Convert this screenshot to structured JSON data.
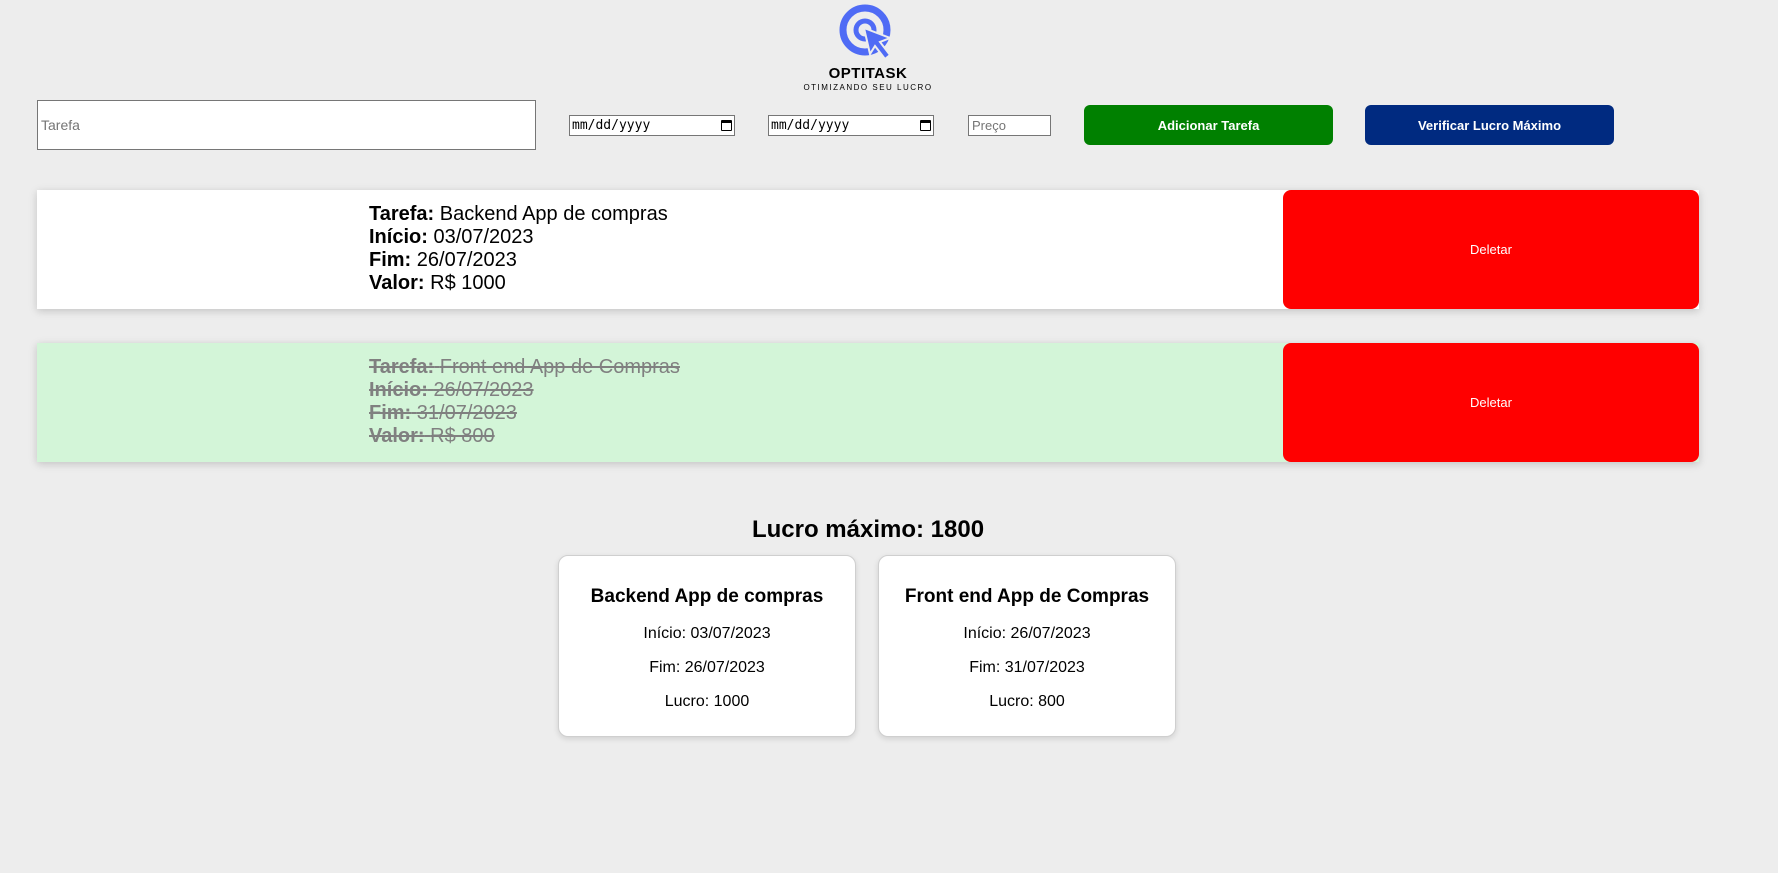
{
  "logo": {
    "title": "OPTITASK",
    "subtitle": "OTIMIZANDO SEU LUCRO",
    "icon": "cursor-target-icon",
    "color": "#4f6bf5"
  },
  "form": {
    "task_placeholder": "Tarefa",
    "start_date_placeholder": "mm/dd/yyyy",
    "end_date_placeholder": "mm/dd/yyyy",
    "price_placeholder": "Preço",
    "add_label": "Adicionar Tarefa",
    "check_label": "Verificar Lucro Máximo"
  },
  "labels": {
    "task": "Tarefa:",
    "start": "Início:",
    "end": "Fim:",
    "value": "Valor:",
    "delete": "Deletar"
  },
  "tasks": [
    {
      "name": "Backend App de compras",
      "start": "03/07/2023",
      "end": "26/07/2023",
      "value": "R$ 1000",
      "done": false
    },
    {
      "name": "Front end App de Compras",
      "start": "26/07/2023",
      "end": "31/07/2023",
      "value": "R$ 800",
      "done": true
    }
  ],
  "result": {
    "title": "Lucro máximo: 1800",
    "cards": [
      {
        "title": "Backend App de compras",
        "start": "Início: 03/07/2023",
        "end": "Fim: 26/07/2023",
        "profit": "Lucro: 1000"
      },
      {
        "title": "Front end App de Compras",
        "start": "Início: 26/07/2023",
        "end": "Fim: 31/07/2023",
        "profit": "Lucro: 800"
      }
    ]
  },
  "colors": {
    "add_button": "#008000",
    "check_button": "#002a80",
    "delete_button": "#ff0000",
    "done_task_bg": "#d3f5d8",
    "background": "#ededed"
  }
}
